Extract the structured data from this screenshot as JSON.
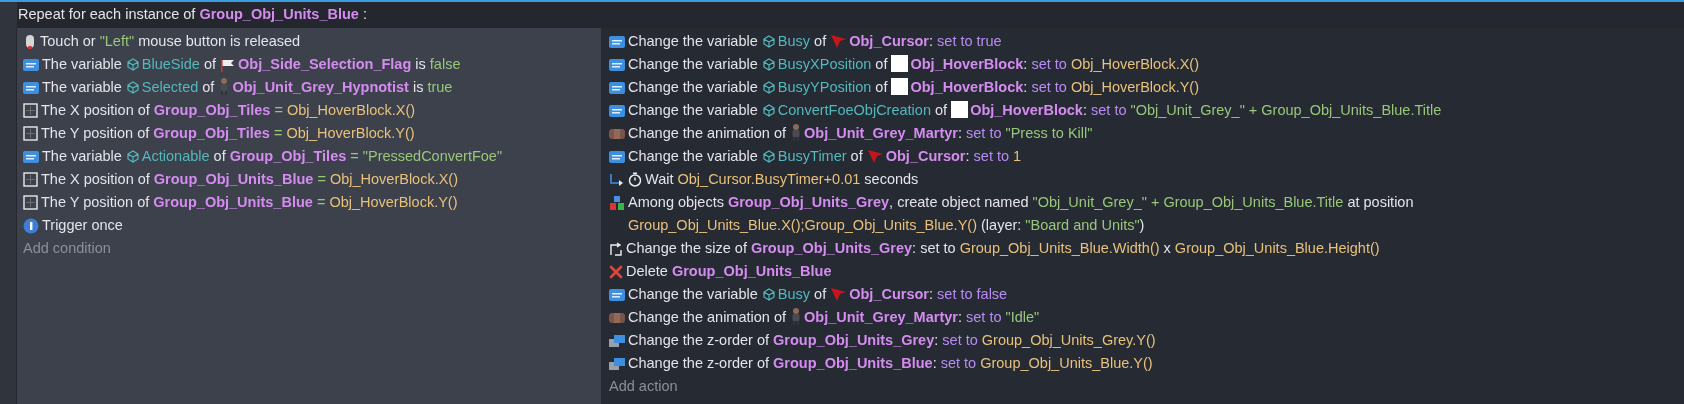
{
  "event": {
    "header": [
      {
        "kind": "text",
        "text": "Repeat for each instance of "
      },
      {
        "kind": "object",
        "text": "Group_Obj_Units_Blue"
      },
      {
        "kind": "text",
        "text": " :"
      }
    ],
    "conditions": [
      {
        "kind": "mouse",
        "parts": [
          {
            "kind": "text",
            "text": "Touch or "
          },
          {
            "kind": "value",
            "text": "\"Left\""
          },
          {
            "kind": "text",
            "text": " mouse button is released"
          }
        ]
      },
      {
        "kind": "variable",
        "parts": [
          {
            "kind": "text",
            "text": "The variable "
          },
          {
            "kind": "variable",
            "text": "BlueSide"
          },
          {
            "kind": "text",
            "text": " of "
          },
          {
            "kind": "flag"
          },
          {
            "kind": "object",
            "text": "Obj_Side_Selection_Flag"
          },
          {
            "kind": "text",
            "text": " is "
          },
          {
            "kind": "value",
            "text": "false"
          }
        ]
      },
      {
        "kind": "variable",
        "parts": [
          {
            "kind": "text",
            "text": "The variable "
          },
          {
            "kind": "variable",
            "text": "Selected"
          },
          {
            "kind": "text",
            "text": " of "
          },
          {
            "kind": "figure"
          },
          {
            "kind": "object",
            "text": "Obj_Unit_Grey_Hypnotist"
          },
          {
            "kind": "text",
            "text": " is "
          },
          {
            "kind": "value",
            "text": "true"
          }
        ]
      },
      {
        "kind": "position",
        "parts": [
          {
            "kind": "text",
            "text": "The X position of "
          },
          {
            "kind": "object",
            "text": "Group_Obj_Tiles"
          },
          {
            "kind": "value",
            "text": " = "
          },
          {
            "kind": "expr",
            "text": "Obj_HoverBlock.X()"
          }
        ]
      },
      {
        "kind": "position",
        "parts": [
          {
            "kind": "text",
            "text": "The Y position of "
          },
          {
            "kind": "object",
            "text": "Group_Obj_Tiles"
          },
          {
            "kind": "value",
            "text": " = "
          },
          {
            "kind": "expr",
            "text": "Obj_HoverBlock.Y()"
          }
        ]
      },
      {
        "kind": "variable",
        "parts": [
          {
            "kind": "text",
            "text": "The variable "
          },
          {
            "kind": "variable",
            "text": "Actionable"
          },
          {
            "kind": "text",
            "text": " of "
          },
          {
            "kind": "object",
            "text": "Group_Obj_Tiles"
          },
          {
            "kind": "value",
            "text": " = "
          },
          {
            "kind": "value",
            "text": "\"PressedConvertFoe\""
          }
        ]
      },
      {
        "kind": "position",
        "parts": [
          {
            "kind": "text",
            "text": "The X position of "
          },
          {
            "kind": "object",
            "text": "Group_Obj_Units_Blue"
          },
          {
            "kind": "value",
            "text": " = "
          },
          {
            "kind": "expr",
            "text": "Obj_HoverBlock.X()"
          }
        ]
      },
      {
        "kind": "position",
        "parts": [
          {
            "kind": "text",
            "text": "The Y position of "
          },
          {
            "kind": "object",
            "text": "Group_Obj_Units_Blue"
          },
          {
            "kind": "value",
            "text": " = "
          },
          {
            "kind": "expr",
            "text": "Obj_HoverBlock.Y()"
          }
        ]
      },
      {
        "kind": "trigger",
        "parts": [
          {
            "kind": "text",
            "text": "Trigger once"
          }
        ]
      }
    ],
    "add_condition": "Add condition",
    "actions": [
      {
        "kind": "variable",
        "parts": [
          {
            "kind": "text",
            "text": "Change the variable "
          },
          {
            "kind": "variable",
            "text": "Busy"
          },
          {
            "kind": "text",
            "text": " of "
          },
          {
            "kind": "cursor"
          },
          {
            "kind": "object",
            "text": "Obj_Cursor"
          },
          {
            "kind": "text",
            "text": ": "
          },
          {
            "kind": "op",
            "text": "set to true"
          }
        ]
      },
      {
        "kind": "variable",
        "parts": [
          {
            "kind": "text",
            "text": "Change the variable "
          },
          {
            "kind": "variable",
            "text": "BusyXPosition"
          },
          {
            "kind": "text",
            "text": " of "
          },
          {
            "kind": "block"
          },
          {
            "kind": "object",
            "text": "Obj_HoverBlock"
          },
          {
            "kind": "text",
            "text": ": "
          },
          {
            "kind": "op",
            "text": "set to "
          },
          {
            "kind": "expr",
            "text": "Obj_HoverBlock.X()"
          }
        ]
      },
      {
        "kind": "variable",
        "parts": [
          {
            "kind": "text",
            "text": "Change the variable "
          },
          {
            "kind": "variable",
            "text": "BusyYPosition"
          },
          {
            "kind": "text",
            "text": " of "
          },
          {
            "kind": "block"
          },
          {
            "kind": "object",
            "text": "Obj_HoverBlock"
          },
          {
            "kind": "text",
            "text": ": "
          },
          {
            "kind": "op",
            "text": "set to "
          },
          {
            "kind": "expr",
            "text": "Obj_HoverBlock.Y()"
          }
        ]
      },
      {
        "kind": "variable",
        "parts": [
          {
            "kind": "text",
            "text": "Change the variable "
          },
          {
            "kind": "variable",
            "text": "ConvertFoeObjCreation"
          },
          {
            "kind": "text",
            "text": " of "
          },
          {
            "kind": "block"
          },
          {
            "kind": "object",
            "text": "Obj_HoverBlock"
          },
          {
            "kind": "text",
            "text": ": "
          },
          {
            "kind": "op",
            "text": "set to "
          },
          {
            "kind": "value",
            "text": "\"Obj_Unit_Grey_\" + Group_Obj_Units_Blue.Title"
          }
        ]
      },
      {
        "kind": "animation",
        "parts": [
          {
            "kind": "text",
            "text": "Change the animation of "
          },
          {
            "kind": "figure"
          },
          {
            "kind": "object",
            "text": "Obj_Unit_Grey_Martyr"
          },
          {
            "kind": "text",
            "text": ": "
          },
          {
            "kind": "op",
            "text": "set to "
          },
          {
            "kind": "value",
            "text": "\"Press to Kill\""
          }
        ]
      },
      {
        "kind": "variable",
        "parts": [
          {
            "kind": "text",
            "text": "Change the variable "
          },
          {
            "kind": "variable",
            "text": "BusyTimer"
          },
          {
            "kind": "text",
            "text": " of "
          },
          {
            "kind": "cursor"
          },
          {
            "kind": "object",
            "text": "Obj_Cursor"
          },
          {
            "kind": "text",
            "text": ": "
          },
          {
            "kind": "op",
            "text": "set to "
          },
          {
            "kind": "expr",
            "text": "1"
          }
        ]
      },
      {
        "kind": "wait",
        "parts": [
          {
            "kind": "text",
            "text": "Wait "
          },
          {
            "kind": "expr",
            "text": "Obj_Cursor.BusyTimer+0.01"
          },
          {
            "kind": "text",
            "text": " seconds"
          }
        ]
      },
      {
        "kind": "create",
        "parts": [
          {
            "kind": "text",
            "text": "Among objects "
          },
          {
            "kind": "object",
            "text": "Group_Obj_Units_Grey"
          },
          {
            "kind": "text",
            "text": ", create object named "
          },
          {
            "kind": "value",
            "text": "\"Obj_Unit_Grey_\" + Group_Obj_Units_Blue.Title"
          },
          {
            "kind": "text",
            "text": " at position "
          },
          {
            "kind": "expr",
            "text": "Group_Obj_Units_Blue.X();Group_Obj_Units_Blue.Y()"
          },
          {
            "kind": "text",
            "text": " (layer: "
          },
          {
            "kind": "value",
            "text": "\"Board and Units\""
          },
          {
            "kind": "text",
            "text": ")"
          }
        ]
      },
      {
        "kind": "resize",
        "parts": [
          {
            "kind": "text",
            "text": "Change the size of "
          },
          {
            "kind": "object",
            "text": "Group_Obj_Units_Grey"
          },
          {
            "kind": "text",
            "text": ": set to "
          },
          {
            "kind": "expr",
            "text": "Group_Obj_Units_Blue.Width()"
          },
          {
            "kind": "text",
            "text": " x "
          },
          {
            "kind": "expr",
            "text": "Group_Obj_Units_Blue.Height()"
          }
        ]
      },
      {
        "kind": "delete",
        "parts": [
          {
            "kind": "text",
            "text": "Delete "
          },
          {
            "kind": "object",
            "text": "Group_Obj_Units_Blue"
          }
        ]
      },
      {
        "kind": "variable",
        "parts": [
          {
            "kind": "text",
            "text": "Change the variable "
          },
          {
            "kind": "variable",
            "text": "Busy"
          },
          {
            "kind": "text",
            "text": " of "
          },
          {
            "kind": "cursor"
          },
          {
            "kind": "object",
            "text": "Obj_Cursor"
          },
          {
            "kind": "text",
            "text": ": "
          },
          {
            "kind": "op",
            "text": "set to false"
          }
        ]
      },
      {
        "kind": "animation",
        "parts": [
          {
            "kind": "text",
            "text": "Change the animation of "
          },
          {
            "kind": "figure"
          },
          {
            "kind": "object",
            "text": "Obj_Unit_Grey_Martyr"
          },
          {
            "kind": "text",
            "text": ": "
          },
          {
            "kind": "op",
            "text": "set to "
          },
          {
            "kind": "value",
            "text": "\"Idle\""
          }
        ]
      },
      {
        "kind": "zorder",
        "parts": [
          {
            "kind": "text",
            "text": "Change the z-order of "
          },
          {
            "kind": "object",
            "text": "Group_Obj_Units_Grey"
          },
          {
            "kind": "text",
            "text": ": "
          },
          {
            "kind": "op",
            "text": "set to "
          },
          {
            "kind": "expr",
            "text": "Group_Obj_Units_Grey.Y()"
          }
        ]
      },
      {
        "kind": "zorder",
        "parts": [
          {
            "kind": "text",
            "text": "Change the z-order of "
          },
          {
            "kind": "object",
            "text": "Group_Obj_Units_Blue"
          },
          {
            "kind": "text",
            "text": ": "
          },
          {
            "kind": "op",
            "text": "set to "
          },
          {
            "kind": "expr",
            "text": "Group_Obj_Units_Blue.Y()"
          }
        ]
      }
    ],
    "add_action": "Add action"
  }
}
